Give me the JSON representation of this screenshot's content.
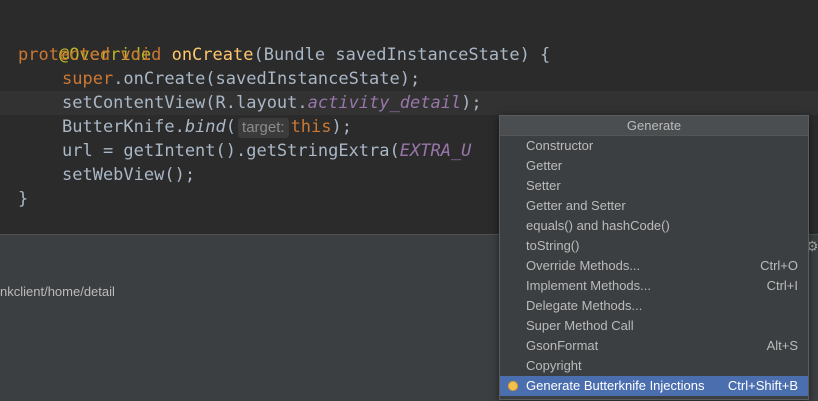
{
  "code": {
    "annotation": "@Override",
    "sig_protected": "protected",
    "sig_void": "void",
    "sig_method": "onCreate",
    "sig_params": "(Bundle savedInstanceState) {",
    "l2_super": "super",
    "l2_rest": ".onCreate(savedInstanceState);",
    "l3_call": "setContentView(R.layout.",
    "l3_field": "activity_detail",
    "l3_end": ");",
    "l4_call": "ButterKnife.",
    "l4_method": "bind",
    "l4_paren": "(",
    "l4_hint": "target:",
    "l4_this": "this",
    "l4_end": ");",
    "l5_call": "url = getIntent().getStringExtra(",
    "l5_const": "EXTRA_U",
    "l6_call": "setWebView();",
    "close_brace": "}"
  },
  "panel": {
    "path": "nkclient/home/detail"
  },
  "popup": {
    "title": "Generate",
    "items": [
      {
        "label": "Constructor",
        "shortcut": ""
      },
      {
        "label": "Getter",
        "shortcut": ""
      },
      {
        "label": "Setter",
        "shortcut": ""
      },
      {
        "label": "Getter and Setter",
        "shortcut": ""
      },
      {
        "label": "equals() and hashCode()",
        "shortcut": ""
      },
      {
        "label": "toString()",
        "shortcut": ""
      },
      {
        "label": "Override Methods...",
        "shortcut": "Ctrl+O"
      },
      {
        "label": "Implement Methods...",
        "shortcut": "Ctrl+I"
      },
      {
        "label": "Delegate Methods...",
        "shortcut": ""
      },
      {
        "label": "Super Method Call",
        "shortcut": ""
      },
      {
        "label": "GsonFormat",
        "shortcut": "Alt+S"
      },
      {
        "label": "Copyright",
        "shortcut": ""
      },
      {
        "label": "Generate Butterknife Injections",
        "shortcut": "Ctrl+Shift+B"
      }
    ]
  },
  "colors": {
    "editor_bg": "#2b2b2b",
    "keyword": "#cc7832",
    "method": "#ffc66d",
    "field": "#9876aa",
    "annotation": "#bbb529",
    "selection": "#4b6eaf"
  }
}
